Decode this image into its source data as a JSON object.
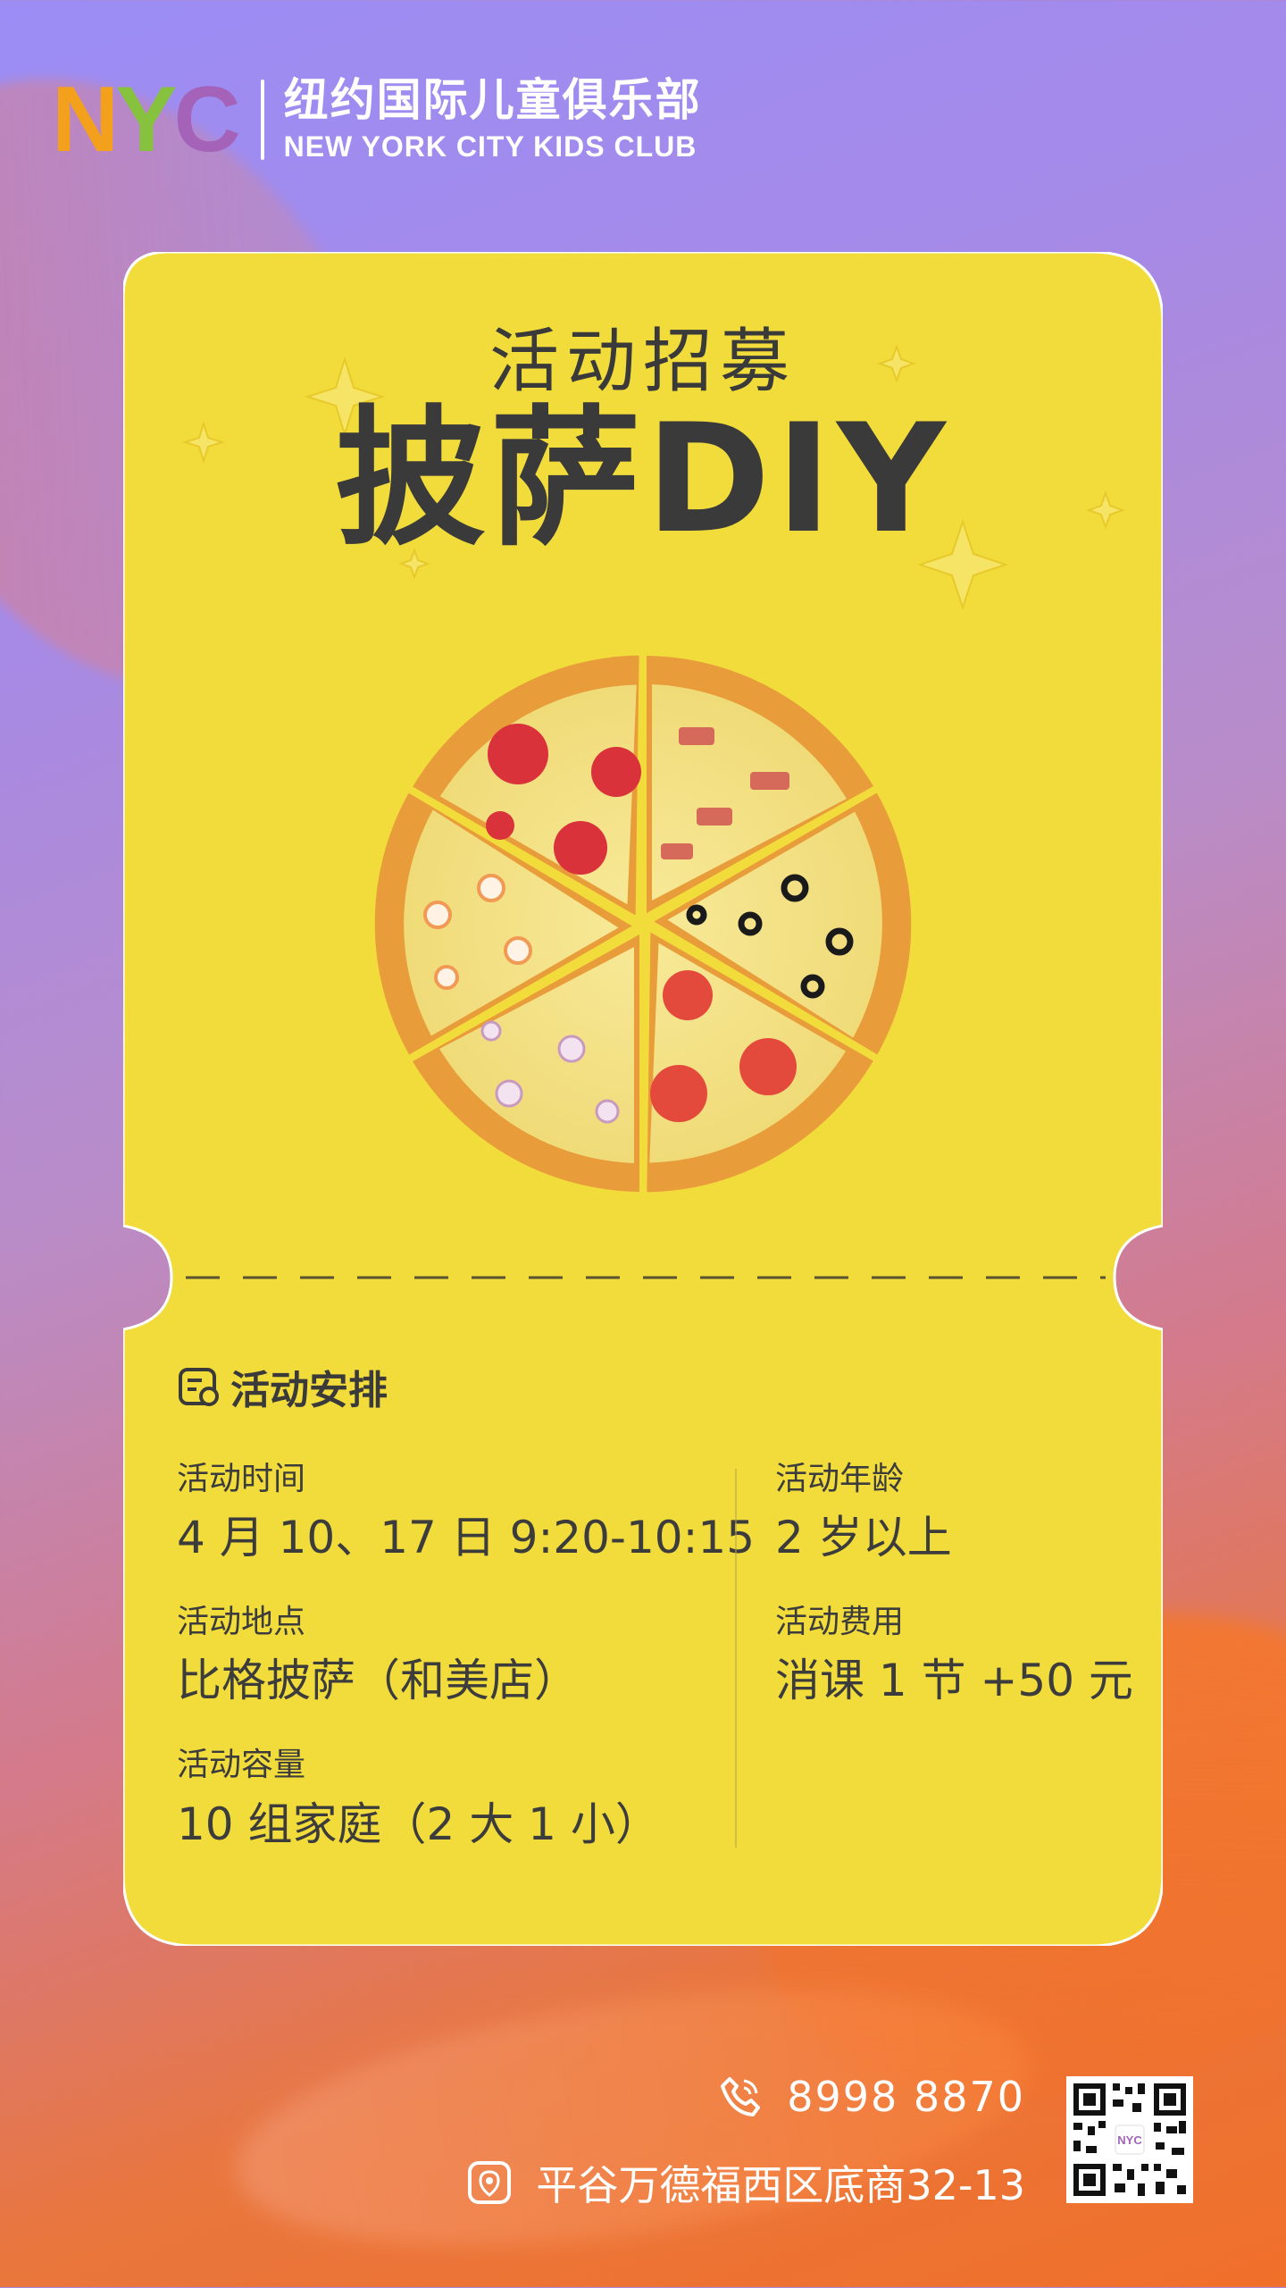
{
  "logo": {
    "letters": [
      "N",
      "Y",
      "C"
    ],
    "cn": "纽约国际儿童俱乐部",
    "en": "NEW YORK CITY KIDS CLUB"
  },
  "header": {
    "subtitle": "活动招募",
    "title": "披萨DIY"
  },
  "schedule": {
    "title": "活动安排",
    "left": [
      {
        "label": "活动时间",
        "value": "4 月 10、17 日 9:20-10:15"
      },
      {
        "label": "活动地点",
        "value": "比格披萨（和美店）"
      },
      {
        "label": "活动容量",
        "value": "10 组家庭（2 大 1 小）"
      }
    ],
    "right": [
      {
        "label": "活动年龄",
        "value": "2 岁以上"
      },
      {
        "label": "活动费用",
        "value": "消课 1 节 +50 元"
      }
    ]
  },
  "contact": {
    "phone": "8998  8870",
    "address": "平谷万德福西区底商32-13",
    "qr_label": "NYC"
  },
  "colors": {
    "ticket": "#f2dc3c",
    "text": "#3a3a3a",
    "nyc_n": "#f3a11d",
    "nyc_y": "#86c23e",
    "nyc_c": "#a463b8"
  }
}
